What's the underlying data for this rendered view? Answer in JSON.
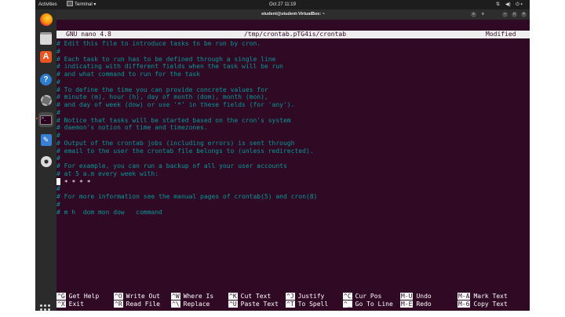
{
  "topbar": {
    "activities": "Activities",
    "app_name": "Terminal",
    "clock": "Oct 27  11:19"
  },
  "terminal": {
    "title": "student@student-VirtualBox: ~"
  },
  "nano": {
    "version": "GNU nano 4.8",
    "filename": "/tmp/crontab.pTG4is/crontab",
    "status": "Modified",
    "lines": [
      "# Edit this file to introduce tasks to be run by cron.",
      "#",
      "# Each task to run has to be defined through a single line",
      "# indicating with different fields when the task will be run",
      "# and what command to run for the task",
      "#",
      "# To define the time you can provide concrete values for",
      "# minute (m), hour (h), day of month (dom), month (mon),",
      "# and day of week (dow) or use '*' in these fields (for 'any').",
      "#",
      "# Notice that tasks will be started based on the cron's system",
      "# daemon's notion of time and timezones.",
      "#",
      "# Output of the crontab jobs (including errors) is sent through",
      "# email to the user the crontab file belongs to (unless redirected).",
      "#",
      "# For example, you can run a backup of all your user accounts",
      "# at 5 a.m every week with:",
      "",
      "#",
      "# For more information see the manual pages of crontab(5) and cron(8)",
      "#",
      "# m h  dom mon dow   command"
    ],
    "cursor_line_text": "* * * *",
    "shortcuts": [
      [
        {
          "key": "^G",
          "label": "Get Help"
        },
        {
          "key": "^X",
          "label": "Exit"
        }
      ],
      [
        {
          "key": "^O",
          "label": "Write Out"
        },
        {
          "key": "^R",
          "label": "Read File"
        }
      ],
      [
        {
          "key": "^W",
          "label": "Where Is"
        },
        {
          "key": "^\\",
          "label": "Replace"
        }
      ],
      [
        {
          "key": "^K",
          "label": "Cut Text"
        },
        {
          "key": "^U",
          "label": "Paste Text"
        }
      ],
      [
        {
          "key": "^J",
          "label": "Justify"
        },
        {
          "key": "^T",
          "label": "To Spell"
        }
      ],
      [
        {
          "key": "^C",
          "label": "Cur Pos"
        },
        {
          "key": "^_",
          "label": "Go To Line"
        }
      ],
      [
        {
          "key": "M-U",
          "label": "Undo"
        },
        {
          "key": "M-E",
          "label": "Redo"
        }
      ],
      [
        {
          "key": "M-A",
          "label": "Mark Text"
        },
        {
          "key": "M-6",
          "label": "Copy Text"
        }
      ]
    ]
  },
  "dock": {
    "items": [
      "firefox-icon",
      "files-icon",
      "software-icon",
      "help-icon",
      "settings-icon",
      "terminal-icon",
      "text-editor-icon",
      "dvd-icon"
    ]
  },
  "colors": {
    "terminal_bg": "#300a24",
    "comment": "#06989a",
    "accent": "#e95420"
  }
}
